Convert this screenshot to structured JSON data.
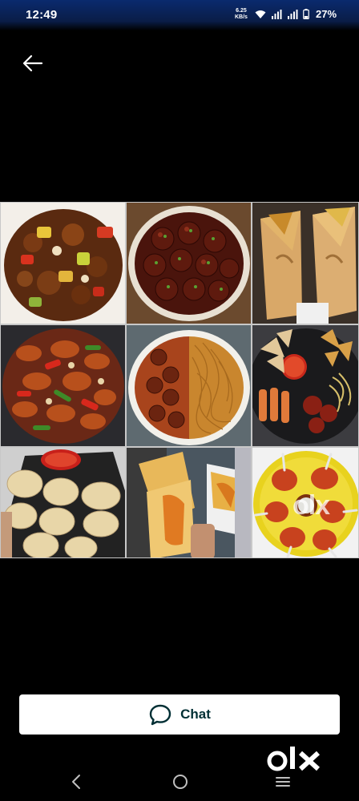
{
  "status_bar": {
    "time": "12:49",
    "net_speed_value": "6.25",
    "net_speed_unit": "KB/s",
    "battery": "27%"
  },
  "gallery": {
    "tiles": [
      {
        "dish": "chilli-mushroom"
      },
      {
        "dish": "manchurian-balls"
      },
      {
        "dish": "spring-rolls"
      },
      {
        "dish": "chilli-chicken"
      },
      {
        "dish": "manchurian-noodles"
      },
      {
        "dish": "snack-platter"
      },
      {
        "dish": "momos-with-chutney"
      },
      {
        "dish": "egg-rolls"
      },
      {
        "dish": "chicken-lollipop"
      }
    ],
    "watermark": "olx"
  },
  "actions": {
    "chat_label": "Chat"
  },
  "branding": {
    "logo_text": "olx"
  },
  "colors": {
    "chat_text": "#002f34",
    "status_bar_top": "#0a2a6e"
  }
}
